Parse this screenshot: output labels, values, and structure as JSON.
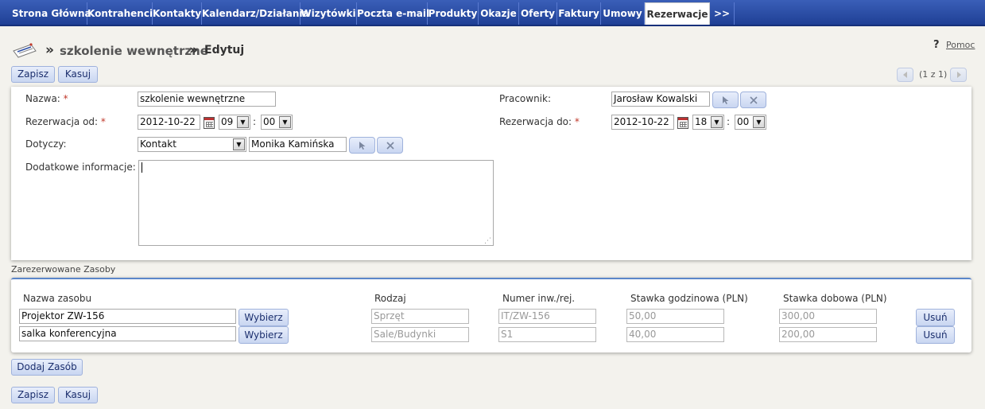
{
  "nav": {
    "tabs": [
      "Strona Główna",
      "Kontrahenci",
      "Kontakty",
      "Kalendarz/Działania",
      "Wizytówki",
      "Poczta e-mail",
      "Produkty",
      "Okazje",
      "Oferty",
      "Faktury",
      "Umowy",
      "Rezerwacje",
      ">>"
    ],
    "active": "Rezerwacje"
  },
  "header": {
    "separator": "»",
    "record_title": "szkolenie wewnętrzne",
    "action": "Edytuj",
    "help_icon": "?",
    "help_label": "Pomoc",
    "pagination": "(1 z 1)"
  },
  "toolbar": {
    "save_label": "Zapisz",
    "cancel_label": "Kasuj"
  },
  "form": {
    "name_label": "Nazwa:",
    "name_value": "szkolenie wewnętrzne",
    "from_label": "Rezerwacja od:",
    "from_date": "2012-10-22",
    "from_hour": "09",
    "from_minute": "00",
    "time_sep": ":",
    "regards_label": "Dotyczy:",
    "regards_type": "Kontakt",
    "regards_value": "Monika Kamińska",
    "info_label": "Dodatkowe informacje:",
    "info_value": "",
    "employee_label": "Pracownik:",
    "employee_value": "Jarosław Kowalski",
    "to_label": "Rezerwacja do:",
    "to_date": "2012-10-22",
    "to_hour": "18",
    "to_minute": "00",
    "required_mark": "*"
  },
  "resources": {
    "section_title": "Zarezerwowane Zasoby",
    "columns": [
      "Nazwa zasobu",
      "Rodzaj",
      "Numer inw./rej.",
      "Stawka godzinowa (PLN)",
      "Stawka dobowa (PLN)"
    ],
    "choose_label": "Wybierz",
    "remove_label": "Usuń",
    "add_label": "Dodaj Zasób",
    "rows": [
      {
        "name": "Projektor ZW-156",
        "type": "Sprzęt",
        "number": "IT/ZW-156",
        "hourly": "50,00",
        "daily": "300,00"
      },
      {
        "name": "salka konferencyjna",
        "type": "Sale/Budynki",
        "number": "S1",
        "hourly": "40,00",
        "daily": "200,00"
      }
    ]
  },
  "icons": {
    "module": "reservations-icon",
    "calendar": "calendar-icon",
    "select": "cursor-arrow-icon",
    "clear": "close-x-icon",
    "prev": "prev-arrow-icon",
    "next": "next-arrow-icon"
  }
}
